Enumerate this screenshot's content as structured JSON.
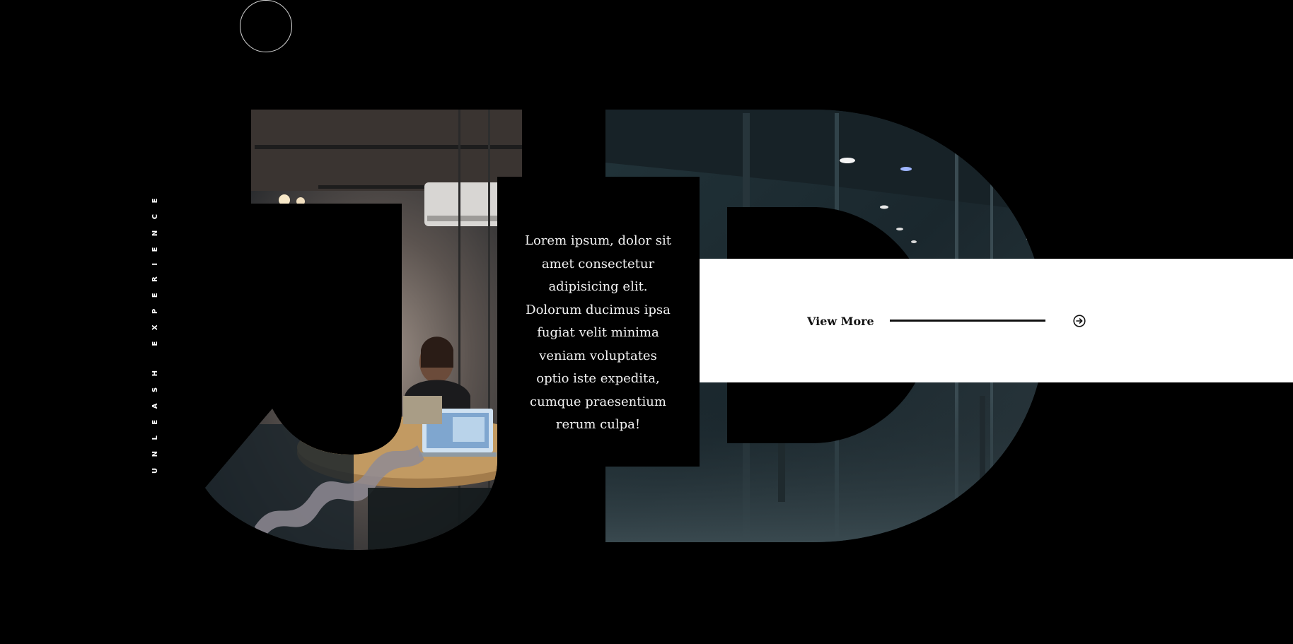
{
  "hero": {
    "tagline": "UNLEASH EXPERIENCE",
    "intro": "Lorem ipsum, dolor sit amet consectetur adipisicing elit. Dolorum ducimus ipsa fugiat velit minima veniam voluptates optio iste expedita, cumque praesentium rerum culpa!",
    "monogram_letters": [
      "J",
      "D"
    ],
    "monogram_fill_image": "office-at-night-photo"
  },
  "cta": {
    "label": "View More",
    "icon": "arrow-circle-right-icon"
  },
  "colors": {
    "background": "#000000",
    "band": "#ffffff",
    "text_light": "#f2f2f2",
    "text_dark": "#111111"
  }
}
